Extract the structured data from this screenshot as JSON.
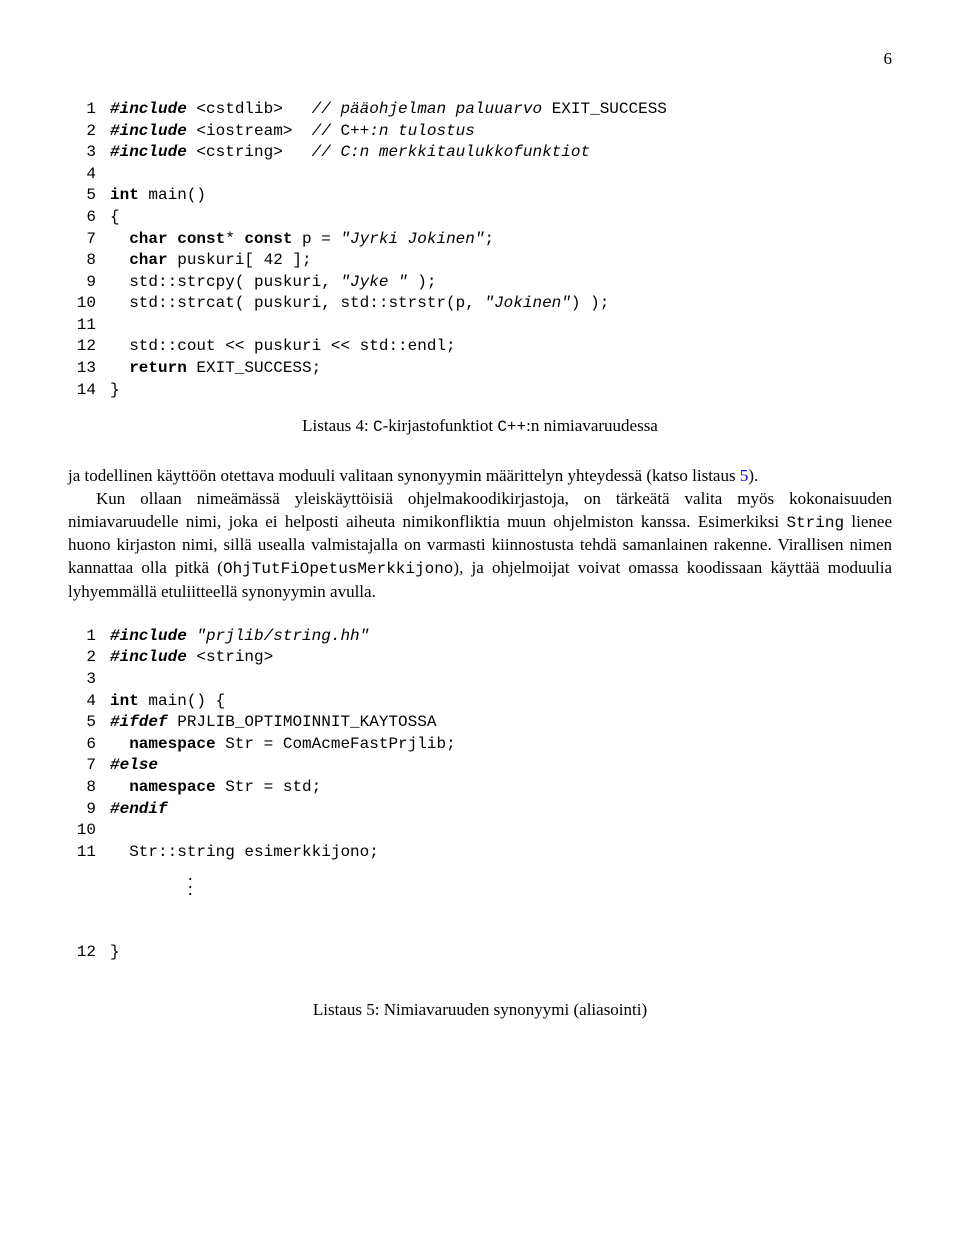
{
  "page_number": "6",
  "code1": {
    "lines": [
      {
        "n": "1",
        "seg": [
          {
            "t": "#include ",
            "c": "kw-it"
          },
          {
            "t": "<cstdlib>   ",
            "c": ""
          },
          {
            "t": "// pääohjelman paluuarvo ",
            "c": "it"
          },
          {
            "t": "EXIT_SUCCESS",
            "c": ""
          }
        ]
      },
      {
        "n": "2",
        "seg": [
          {
            "t": "#include ",
            "c": "kw-it"
          },
          {
            "t": "<iostream>  ",
            "c": ""
          },
          {
            "t": "// ",
            "c": "it"
          },
          {
            "t": "C++",
            "c": ""
          },
          {
            "t": ":n tulostus",
            "c": "it"
          }
        ]
      },
      {
        "n": "3",
        "seg": [
          {
            "t": "#include ",
            "c": "kw-it"
          },
          {
            "t": "<cstring>   ",
            "c": ""
          },
          {
            "t": "// C:n merkkitaulukkofunktiot",
            "c": "it"
          }
        ]
      },
      {
        "n": "4",
        "seg": []
      },
      {
        "n": "5",
        "seg": [
          {
            "t": "int",
            "c": "kw"
          },
          {
            "t": " main()",
            "c": ""
          }
        ]
      },
      {
        "n": "6",
        "seg": [
          {
            "t": "{",
            "c": ""
          }
        ]
      },
      {
        "n": "7",
        "seg": [
          {
            "t": "  ",
            "c": ""
          },
          {
            "t": "char const",
            "c": "kw"
          },
          {
            "t": "* ",
            "c": ""
          },
          {
            "t": "const",
            "c": "kw"
          },
          {
            "t": " p = ",
            "c": ""
          },
          {
            "t": "\"Jyrki Jokinen\"",
            "c": "it"
          },
          {
            "t": ";",
            "c": ""
          }
        ]
      },
      {
        "n": "8",
        "seg": [
          {
            "t": "  ",
            "c": ""
          },
          {
            "t": "char",
            "c": "kw"
          },
          {
            "t": " puskuri[ 42 ];",
            "c": ""
          }
        ]
      },
      {
        "n": "9",
        "seg": [
          {
            "t": "  std::strcpy( puskuri, ",
            "c": ""
          },
          {
            "t": "\"Jyke \"",
            "c": "it"
          },
          {
            "t": " );",
            "c": ""
          }
        ]
      },
      {
        "n": "10",
        "seg": [
          {
            "t": "  std::strcat( puskuri, std::strstr(p, ",
            "c": ""
          },
          {
            "t": "\"Jokinen\"",
            "c": "it"
          },
          {
            "t": ") );",
            "c": ""
          }
        ]
      },
      {
        "n": "11",
        "seg": []
      },
      {
        "n": "12",
        "seg": [
          {
            "t": "  std::cout << puskuri << std::endl;",
            "c": ""
          }
        ]
      },
      {
        "n": "13",
        "seg": [
          {
            "t": "  ",
            "c": ""
          },
          {
            "t": "return",
            "c": "kw"
          },
          {
            "t": " EXIT_SUCCESS;",
            "c": ""
          }
        ]
      },
      {
        "n": "14",
        "seg": [
          {
            "t": "}",
            "c": ""
          }
        ]
      }
    ],
    "caption_pre": "Listaus 4: ",
    "caption_c": "C",
    "caption_mid": "-kirjastofunktiot ",
    "caption_cpp": "C++",
    "caption_post": ":n nimiavaruudessa"
  },
  "para1": {
    "pre": "ja todellinen käyttöön otettava moduuli valitaan synonyymin määrittelyn yhteydessä (katso listaus ",
    "link": "5",
    "post": ")."
  },
  "para2": {
    "pre": "Kun ollaan nimeämässä yleiskäyttöisiä ohjelmakoodikirjastoja, on tärkeätä valita myös kokonaisuuden nimiavaruudelle nimi, joka ei helposti aiheuta nimikonfliktia muun ohjelmiston kanssa. Esimerkiksi ",
    "m1": "String",
    "mid1": " lienee huono kirjaston nimi, sillä usealla valmistajalla on varmasti kiinnostusta tehdä samanlainen rakenne. Virallisen nimen kannattaa olla pitkä (",
    "m2": "OhjTutFiOpetusMerkkijono",
    "mid2": "), ja ohjelmoijat voivat omassa koodissaan käyttää moduulia lyhyemmällä etuliitteellä synonyymin avulla."
  },
  "code2": {
    "lines": [
      {
        "n": "1",
        "seg": [
          {
            "t": "#include ",
            "c": "kw-it"
          },
          {
            "t": "\"prjlib/string.hh\"",
            "c": "it"
          }
        ]
      },
      {
        "n": "2",
        "seg": [
          {
            "t": "#include ",
            "c": "kw-it"
          },
          {
            "t": "<string>",
            "c": ""
          }
        ]
      },
      {
        "n": "3",
        "seg": []
      },
      {
        "n": "4",
        "seg": [
          {
            "t": "int",
            "c": "kw"
          },
          {
            "t": " main() {",
            "c": ""
          }
        ]
      },
      {
        "n": "5",
        "seg": [
          {
            "t": "#ifdef ",
            "c": "kw-it"
          },
          {
            "t": "PRJLIB_OPTIMOINNIT_KAYTOSSA",
            "c": ""
          }
        ]
      },
      {
        "n": "6",
        "seg": [
          {
            "t": "  ",
            "c": ""
          },
          {
            "t": "namespace",
            "c": "kw"
          },
          {
            "t": " Str = ComAcmeFastPrjlib;",
            "c": ""
          }
        ]
      },
      {
        "n": "7",
        "seg": [
          {
            "t": "#else",
            "c": "kw-it"
          }
        ]
      },
      {
        "n": "8",
        "seg": [
          {
            "t": "  ",
            "c": ""
          },
          {
            "t": "namespace",
            "c": "kw"
          },
          {
            "t": " Str = std;",
            "c": ""
          }
        ]
      },
      {
        "n": "9",
        "seg": [
          {
            "t": "#endif",
            "c": "kw-it"
          }
        ]
      },
      {
        "n": "10",
        "seg": []
      },
      {
        "n": "11",
        "seg": [
          {
            "t": "  Str::string esimerkkijono;",
            "c": ""
          }
        ]
      }
    ],
    "line12_n": "12",
    "line12_t": "}",
    "caption": "Listaus 5: Nimiavaruuden synonyymi (aliasointi)"
  }
}
